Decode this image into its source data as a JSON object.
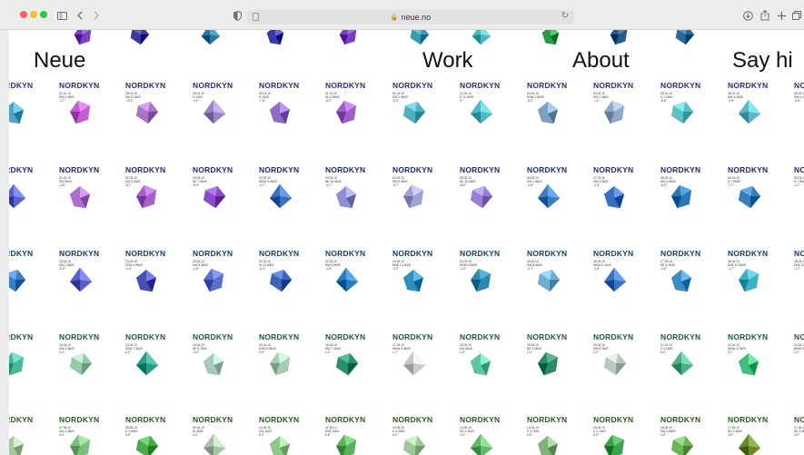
{
  "browser": {
    "url": "neue.no",
    "colors": {
      "close": "#ff5f57",
      "minimize": "#febc2e",
      "maximize": "#28c840"
    }
  },
  "nav": {
    "brand": "Neue",
    "work": "Work",
    "about": "About",
    "sayhi": "Say hi"
  },
  "grid": {
    "title": "NORDKYN",
    "rows": [
      {
        "color": "#3a2a6e",
        "gems": [
          "#4fa6c2",
          "#c25fd0",
          "#a974c9",
          "#9a86c4",
          "#8d6bc7",
          "#a060c9",
          "#4fb0c0",
          "#4fb8c2",
          "#7f9fc0",
          "#8fa9c7",
          "#5cc1c4",
          "#5bb8c6"
        ],
        "dates": [
          [
            "21.01.10",
            "SW 0.3M/S",
            "-1.7°"
          ],
          [
            "28.01.10",
            "SW 5.1M/S",
            "-10.2°"
          ],
          [
            "28.01.10",
            "S 1M/S",
            "-9.1°"
          ],
          [
            "30.01.10",
            "S 1M/S",
            "-7.6°"
          ],
          [
            "31.01.10",
            "SE 6.8M/S",
            "-8.2°"
          ],
          [
            "01.02.10",
            "SW 2.5M/S",
            "-8.3°"
          ],
          [
            "02.02.10",
            "E 11.3M/S",
            "0°"
          ],
          [
            "03.02.10",
            "SSW 1.8M/S",
            "-8.2°"
          ],
          [
            "04.02.10",
            "SW 2.3M/S",
            "-1.1°"
          ],
          [
            "05.02.10",
            "S 1.2M/S",
            "-8.6°"
          ],
          [
            "06.02.10",
            "NW 4.2M/S",
            "-0.5°"
          ]
        ]
      },
      {
        "color": "#1d2a6e",
        "gems": [
          "#5a62c9",
          "#b06fd0",
          "#a760c9",
          "#8b4bc4",
          "#3c6fbd",
          "#8f8fd0",
          "#a0a0d4",
          "#9a7dd6",
          "#3f7ec0",
          "#3a6fc2",
          "#2b78b8",
          "#3580bc"
        ],
        "dates": [
          [
            "31.02.10",
            "SW 5M/S",
            "-4.5°"
          ],
          [
            "02.03.10",
            "SW 3.2M/S",
            "-8.7°"
          ],
          [
            "03.03.10",
            "SE 7.3M/S",
            "-8.9°"
          ],
          [
            "03.03.10",
            "WSW 3.3M/S",
            "-4.7°"
          ],
          [
            "03.03.10",
            "NE 10.3M/S",
            "-9.1°"
          ],
          [
            "04.03.10",
            "SW 6.3M/S",
            "-5.7°"
          ],
          [
            "05.03.10",
            "SE 10.4M/S",
            "-8.6°"
          ],
          [
            "06.03.10",
            "SW 1.5M/S",
            "-0.8°"
          ],
          [
            "07.03.10",
            "SW 3.3M/S",
            "-1.3°"
          ],
          [
            "08.03.10",
            "NW 4.5M/S",
            "-8.2°"
          ],
          [
            "09.03.10",
            "N 7.9M/S",
            "-2.7°"
          ]
        ]
      },
      {
        "color": "#183b5e",
        "gems": [
          "#3c7fc0",
          "#5a5ec8",
          "#4a4fb8",
          "#5a6fcc",
          "#3a66b8",
          "#2a7bbd",
          "#2e8ec0",
          "#2a88b0",
          "#6faed2",
          "#3a74c0",
          "#3b8ec4",
          "#3ab0c6"
        ],
        "dates": [
          [
            "16.03.10",
            "SW 2.3M/S",
            "-0.2°"
          ],
          [
            "19.03.10",
            "SSW 4.9M/S",
            "-0.4°"
          ],
          [
            "20.03.10",
            "SW 5.3M/S",
            "-4.6°"
          ],
          [
            "21.03.10",
            "W 10.3M/S",
            "-0.4°"
          ],
          [
            "22.03.10",
            "NW 9.9M/S",
            "-1.9°"
          ],
          [
            "23.03.10",
            "NNE 10.2M/S",
            "-0.3°"
          ],
          [
            "24.03.10",
            "NNW 9.3M/S",
            "-1.3°"
          ],
          [
            "25.03.10",
            "SW 5.5M/S",
            "-2.7°"
          ],
          [
            "26.03.10",
            "WSW 9.1M/S",
            "-2.6°"
          ],
          [
            "27.03.10",
            "NE 5.1M/S",
            "-3.3°"
          ],
          [
            "28.03.10",
            "ENE 10.3M/S",
            "-1.7°"
          ]
        ]
      },
      {
        "color": "#1d5a3a",
        "gems": [
          "#4ab69a",
          "#98c9a8",
          "#2a9c88",
          "#a8c9c0",
          "#a7ccb2",
          "#2d8f6a",
          "#c9c9c9",
          "#5dc7a4",
          "#2c8a64",
          "#b9c9c0",
          "#4fb08a",
          "#3fbf7a"
        ],
        "dates": [
          [
            "15.04.10",
            "SW 4.3M/S",
            "3.3°"
          ],
          [
            "13.04.10",
            "SSW 7.3M/S",
            "6.2°"
          ],
          [
            "16.04.10",
            "SE 5.7M/S",
            "-0.4°"
          ],
          [
            "15.04.10",
            "SSW 5.5M/S",
            "3.5°"
          ],
          [
            "16.04.10",
            "NW 7.4M/S",
            "1.4°"
          ],
          [
            "17.04.10",
            "WSW 5.5M/S",
            "1.7°"
          ],
          [
            "18.04.10",
            "SW 4M/S",
            "1.5°"
          ],
          [
            "19.04.10",
            "NE 3.2M/S",
            "2.4°"
          ],
          [
            "20.04.10",
            "SW 6.7M/S",
            "2.3°"
          ],
          [
            "21.04.10",
            "S 4.1M/S",
            "5.3°"
          ],
          [
            "22.04.10",
            "WSW 4.7M/S",
            "2.1°"
          ]
        ]
      },
      {
        "color": "#2a5a1e",
        "gems": [
          "#a8c8a0",
          "#7dbf7a",
          "#4aa84a",
          "#a9c3a6",
          "#8ec98c",
          "#5ab25c",
          "#9ec99a",
          "#63b766",
          "#7fb27c",
          "#3da04a",
          "#6fb25a",
          "#6a8a2a"
        ],
        "dates": [
          [
            "07.05.10",
            "SW 4.3M/S",
            "4.4°"
          ],
          [
            "08.05.10",
            "S 3.5M/S",
            "3.6°"
          ],
          [
            "09.05.10",
            "W 2M/S",
            "4.3°"
          ],
          [
            "10.05.10",
            "SW 1M/S",
            "5.2°"
          ],
          [
            "11.05.10",
            "ENE 1M/S",
            "6.8°"
          ],
          [
            "12.05.10",
            "S 5.3M/S",
            "6.9°"
          ],
          [
            "13.05.10",
            "SE 3.3M/S",
            "4.4°"
          ],
          [
            "14.05.10",
            "E 5.7M/S",
            "4.5°"
          ],
          [
            "15.05.10",
            "S 2.7M/S",
            "5.5°"
          ],
          [
            "16.05.10",
            "SW 4.5M/S",
            "3.2°"
          ],
          [
            "17.05.10",
            "SE 4.3M/S",
            "4.5°"
          ]
        ]
      }
    ]
  },
  "topStrip": [
    "#7a3fbf",
    "#3a3a9a",
    "#2a7aa0",
    "#3a3aa8",
    "#7a3fbf",
    "#3a9ab0",
    "#4ab8c0",
    "#2a9a4a",
    "#2a5a8a",
    "#2a6a9a"
  ]
}
